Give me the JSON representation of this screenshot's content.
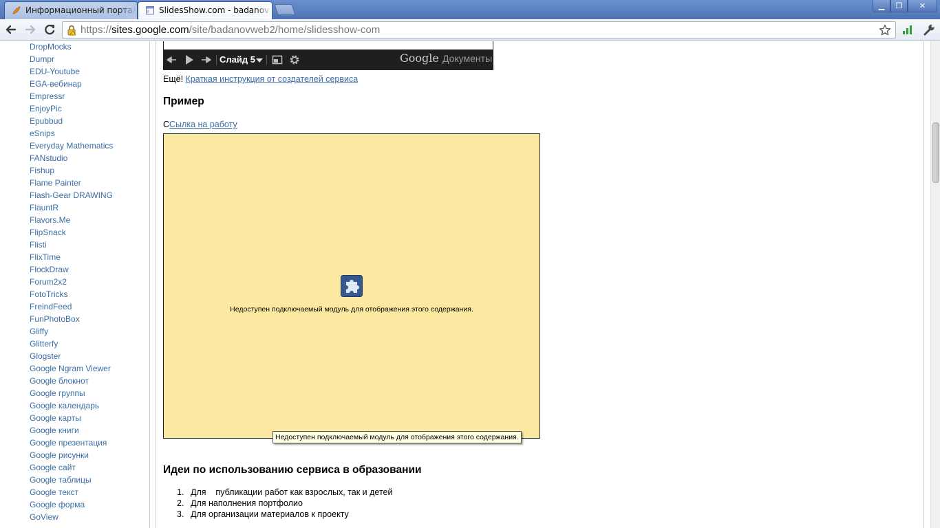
{
  "browser": {
    "tabs": [
      {
        "title": "Информационный портал",
        "favicon": "feather-icon",
        "active": false
      },
      {
        "title": "SlidesShow.com - badanov",
        "favicon": "google-sites-page-icon",
        "active": true
      }
    ],
    "window_controls": {
      "minimize": "▁",
      "maximize": "❐",
      "close": "✕"
    },
    "url": {
      "scheme": "https://",
      "host": "sites.google.com",
      "path": "/site/badanovweb2/home/slidesshow-com"
    }
  },
  "sidebar": {
    "items": [
      "DropMocks",
      "Dumpr",
      "EDU-Youtube",
      "EGA-вебинар",
      "Empressr",
      "EnjoyPic",
      "Epubbud",
      "eSnips",
      "Everyday Mathematics",
      "FANstudio",
      "Fishup",
      "Flame Painter",
      "Flash-Gear DRAWING",
      "FlauntR",
      "Flavors.Me",
      "FlipSnack",
      "Flisti",
      "FlixTime",
      "FlockDraw",
      "Forum2x2",
      "FotoTricks",
      "FreindFeed",
      "FunPhotoBox",
      "Gliffy",
      "Glitterfy",
      "Glogster",
      "Google Ngram Viewer",
      "Google блокнот",
      "Google группы",
      "Google календарь",
      "Google карты",
      "Google книги",
      "Google презентация",
      "Google рисунки",
      "Google сайт",
      "Google таблицы",
      "Google текст",
      "Google форма",
      "GoView"
    ]
  },
  "viewer": {
    "slide_label": "Слайд 5",
    "logo_google": "Google",
    "logo_docs": "Документы"
  },
  "main": {
    "more_prefix": "Ещё! ",
    "more_link": "Краткая инструкция от создателей сервиса",
    "example_heading": "Пример",
    "work_prefix": "С",
    "work_link": "Сылка на работу",
    "plugin_message": "Недоступен подключаемый модуль для отображения этого содержания.",
    "tooltip": "Недоступен подключаемый модуль для отображения этого содержания.",
    "ideas_heading": "Идеи по использованию сервиса в образовании",
    "ideas": [
      {
        "num": "1.",
        "text": "Для    публикации работ как взрослых, так и детей"
      },
      {
        "num": "2.",
        "text": "Для наполнения портфолио"
      },
      {
        "num": "3.",
        "text": "Для организации материалов к проекту"
      }
    ]
  },
  "colors": {
    "link": "#3a6ea5",
    "plugin_bg": "#fbe9a1",
    "tooltip_bg": "#ffffe1"
  }
}
